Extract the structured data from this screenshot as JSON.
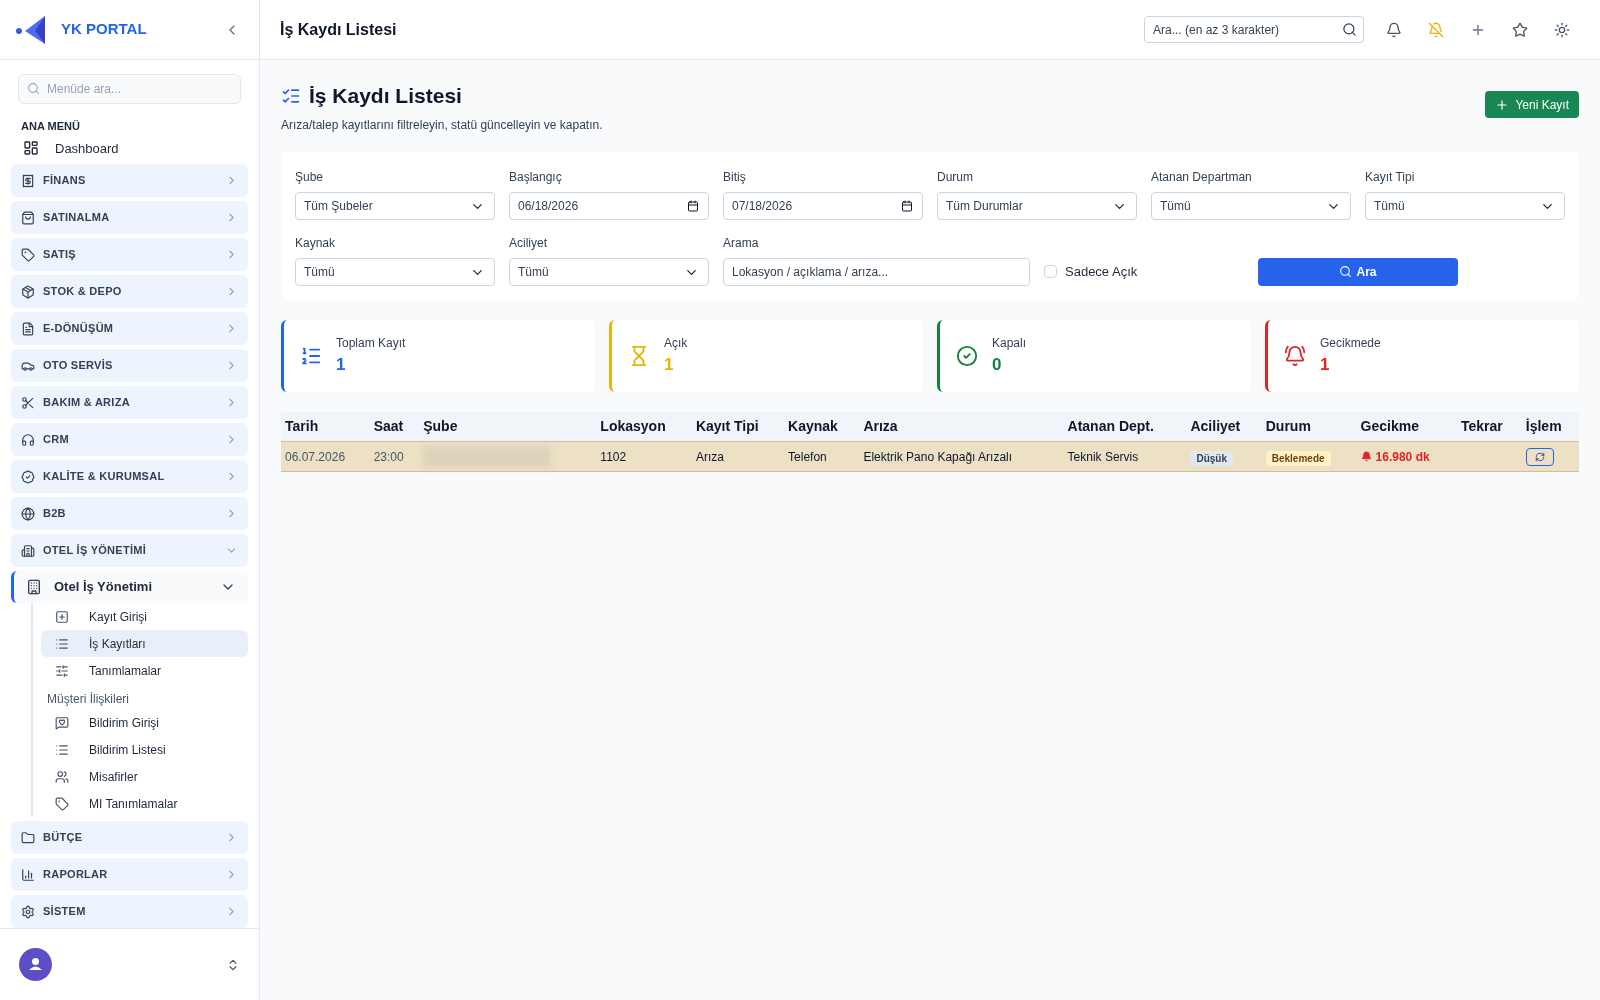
{
  "brand": "YK PORTAL",
  "sidebar": {
    "search_placeholder": "Menüde ara...",
    "section": "ANA MENÜ",
    "dashboard": "Dashboard",
    "groups": [
      {
        "label": "FİNANS",
        "expanded": false
      },
      {
        "label": "SATINALMA",
        "expanded": false
      },
      {
        "label": "SATIŞ",
        "expanded": false
      },
      {
        "label": "STOK & DEPO",
        "expanded": false
      },
      {
        "label": "E-DÖNÜŞÜM",
        "expanded": false
      },
      {
        "label": "OTO SERVİS",
        "expanded": false
      },
      {
        "label": "BAKIM & ARIZA",
        "expanded": false
      },
      {
        "label": "CRM",
        "expanded": false
      },
      {
        "label": "KALİTE & KURUMSAL",
        "expanded": false
      },
      {
        "label": "B2B",
        "expanded": false
      },
      {
        "label": "OTEL İŞ YÖNETİMİ",
        "expanded": true,
        "children": [
          {
            "label": "Otel İş Yönetimi",
            "expanded": true,
            "children": [
              {
                "kind": "link",
                "label": "Kayıt Girişi",
                "selected": false
              },
              {
                "kind": "link",
                "label": "İş Kayıtları",
                "selected": true
              },
              {
                "kind": "link",
                "label": "Tanımlamalar",
                "selected": false
              },
              {
                "kind": "heading",
                "label": "Müşteri İlişkileri"
              },
              {
                "kind": "link",
                "label": "Bildirim Girişi",
                "selected": false
              },
              {
                "kind": "link",
                "label": "Bildirim Listesi",
                "selected": false
              },
              {
                "kind": "link",
                "label": "Misafirler",
                "selected": false
              },
              {
                "kind": "link",
                "label": "MI Tanımlamalar",
                "selected": false
              }
            ]
          }
        ]
      },
      {
        "label": "BÜTÇE",
        "expanded": false
      },
      {
        "label": "RAPORLAR",
        "expanded": false
      },
      {
        "label": "SİSTEM",
        "expanded": false
      }
    ]
  },
  "header": {
    "title": "İş Kaydı Listesi",
    "search_placeholder": "Ara... (en az 3 karakter)"
  },
  "page": {
    "title": "İş Kaydı Listesi",
    "subtitle": "Arıza/talep kayıtlarını filtreleyin, statü güncelleyin ve kapatın.",
    "new_button": "Yeni Kayıt"
  },
  "filters": [
    {
      "kind": "select",
      "label": "Şube",
      "value": "Tüm Şubeler"
    },
    {
      "kind": "date",
      "label": "Başlangıç",
      "value": "06/18/2026"
    },
    {
      "kind": "date",
      "label": "Bitiş",
      "value": "07/18/2026"
    },
    {
      "kind": "select",
      "label": "Durum",
      "value": "Tüm Durumlar"
    },
    {
      "kind": "select",
      "label": "Atanan Departman",
      "value": "Tümü"
    },
    {
      "kind": "select",
      "label": "Kayıt Tipi",
      "value": "Tümü"
    },
    {
      "kind": "select",
      "label": "Kaynak",
      "value": "Tümü"
    },
    {
      "kind": "select",
      "label": "Aciliyet",
      "value": "Tümü"
    },
    {
      "kind": "text",
      "label": "Arama",
      "placeholder": "Lokasyon / açıklama / arıza..."
    }
  ],
  "only_open": {
    "label": "Sadece Açık",
    "checked": false
  },
  "search_button": "Ara",
  "stats": [
    {
      "label": "Toplam Kayıt",
      "value": "1",
      "color": "#2563eb"
    },
    {
      "label": "Açık",
      "value": "1",
      "color": "#eab308"
    },
    {
      "label": "Kapalı",
      "value": "0",
      "color": "#15803d"
    },
    {
      "label": "Gecikmede",
      "value": "1",
      "color": "#dc2626"
    }
  ],
  "table": {
    "columns": [
      "Tarih",
      "Saat",
      "Şube",
      "Lokasyon",
      "Kayıt Tipi",
      "Kaynak",
      "Arıza",
      "Atanan Dept.",
      "Aciliyet",
      "Durum",
      "Gecikme",
      "Tekrar",
      "İşlem"
    ],
    "rows": [
      {
        "date": "06.07.2026",
        "time": "23:00",
        "branch_redacted": true,
        "location": "1102",
        "type": "Arıza",
        "source": "Telefon",
        "fault": "Elektrik Pano Kapağı Arızalı",
        "dept": "Teknik Servis",
        "urgency": "Düşük",
        "status": "Beklemede",
        "delay": "16.980 dk",
        "overdue": true,
        "selected": true
      }
    ]
  }
}
